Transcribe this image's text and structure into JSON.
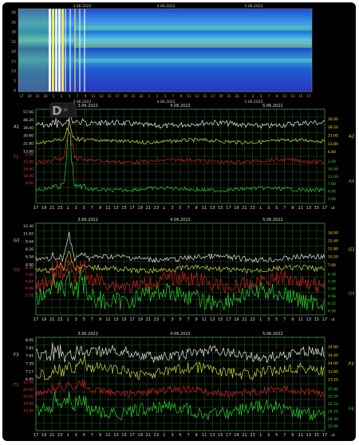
{
  "spectrogram": {
    "date_labels": [
      "3.06.2022",
      "4.06.2022",
      "5.06.2022"
    ],
    "y_ticks": [
      "40",
      "35",
      "30",
      "25",
      "20",
      "15",
      "10",
      "5",
      "0"
    ],
    "hour_ticks": [
      "17",
      "19",
      "21",
      "23",
      "1",
      "3",
      "5",
      "7",
      "9",
      "11",
      "13",
      "15",
      "17",
      "19",
      "21",
      "23",
      "1",
      "3",
      "5",
      "7",
      "9",
      "11",
      "13",
      "15",
      "17",
      "19",
      "21",
      "23",
      "1",
      "3",
      "5",
      "7",
      "9",
      "11",
      "13",
      "15",
      "17"
    ]
  },
  "colors": {
    "white_series": "#e8e8e8",
    "yellow_series": "#d6d645",
    "red_series": "#d42020",
    "green_series": "#2fd12f",
    "grid": "#2a7a2a",
    "left_labels_white": "#e0e0e0",
    "left_labels_red": "#ff3b3b",
    "right_labels_yellow": "#e6e600",
    "right_labels_green": "#2ee02e"
  },
  "chart_data": [
    {
      "type": "line",
      "panel": "A",
      "date_labels": [
        "3.06.2022",
        "4.06.2022",
        "5.06.2022"
      ],
      "x_ticks": [
        "17",
        "19",
        "21",
        "23",
        "1",
        "3",
        "5",
        "7",
        "9",
        "11",
        "13",
        "15",
        "17",
        "19",
        "21",
        "23",
        "1",
        "3",
        "5",
        "7",
        "9",
        "11",
        "13",
        "15",
        "17",
        "19",
        "21",
        "23",
        "1",
        "3",
        "5",
        "7",
        "9",
        "11",
        "13",
        "15",
        "17"
      ],
      "x_unit": "ut",
      "left_axis_labels": [
        "A1",
        "F1"
      ],
      "right_axis_labels": [
        "A2",
        "A4"
      ],
      "left_ticks_white": [
        "57.00",
        "48.20",
        "39.40",
        "30.60",
        "21.80",
        "13.00"
      ],
      "left_ticks_red": [
        "2.00",
        "13.00",
        "16.40",
        "18.40",
        "8.00"
      ],
      "right_ticks_yellow": [
        "36.00",
        "28.20",
        "21.00",
        "13.80",
        "6.60"
      ],
      "right_ticks_green": [
        "2.00",
        "16.00",
        "13.40",
        "7.60",
        "4.60",
        "2.00"
      ],
      "series": [
        {
          "name": "A1",
          "color": "white",
          "baseline": 0.16,
          "amp": 0.03,
          "spike": 0.95
        },
        {
          "name": "A2",
          "color": "yellow",
          "baseline": 0.34,
          "amp": 0.02,
          "spike": 0.75
        },
        {
          "name": "F1",
          "color": "red",
          "baseline": 0.55,
          "amp": 0.02,
          "spike": 0.8
        },
        {
          "name": "A4",
          "color": "green",
          "baseline": 0.85,
          "amp": 0.02,
          "spike": 0.9
        }
      ]
    },
    {
      "type": "line",
      "panel": "G",
      "date_labels": [
        "3.06.2022",
        "4.06.2022",
        "5.06.2022"
      ],
      "x_ticks": [
        "17",
        "19",
        "21",
        "23",
        "1",
        "3",
        "5",
        "7",
        "9",
        "11",
        "13",
        "15",
        "17",
        "19",
        "21",
        "23",
        "1",
        "3",
        "5",
        "7",
        "9",
        "11",
        "13",
        "15",
        "17",
        "19",
        "21",
        "23",
        "1",
        "3",
        "5",
        "7",
        "9",
        "11",
        "13",
        "15",
        "17"
      ],
      "x_unit": "ut",
      "left_axis_labels": [
        "G1",
        "G3"
      ],
      "right_axis_labels": [
        "G2",
        "G4"
      ],
      "left_ticks_white": [
        "13.30",
        "11.62",
        "9.94",
        "8.26",
        "6.58",
        "4.90"
      ],
      "left_ticks_red": [
        "8.36",
        "7.60",
        "6.84",
        "6.08",
        "5.32"
      ],
      "right_ticks_yellow": [
        "18.00",
        "15.40",
        "12.80",
        "10.20",
        "7.60"
      ],
      "right_ticks_green": [
        "6.36",
        "5.90",
        "5.44",
        "4.98",
        "4.52",
        "4.06"
      ],
      "series": [
        {
          "name": "G1",
          "color": "white",
          "baseline": 0.38,
          "amp": 0.03,
          "spike": 0.9
        },
        {
          "name": "G2",
          "color": "yellow",
          "baseline": 0.5,
          "amp": 0.03,
          "spike": 0.5
        },
        {
          "name": "G3",
          "color": "red",
          "baseline": 0.64,
          "amp": 0.08,
          "spike": 0.3
        },
        {
          "name": "G4",
          "color": "green",
          "baseline": 0.8,
          "amp": 0.1,
          "spike": 0.3
        }
      ]
    },
    {
      "type": "line",
      "panel": "F",
      "date_labels": [
        "3.06.2022",
        "4.06.2022",
        "5.06.2022"
      ],
      "x_ticks": [
        "17",
        "19",
        "21",
        "23",
        "1",
        "3",
        "5",
        "7",
        "9",
        "11",
        "13",
        "15",
        "17",
        "19",
        "21",
        "23",
        "1",
        "3",
        "5",
        "7",
        "9",
        "11",
        "13",
        "15",
        "17",
        "19",
        "21",
        "23",
        "1",
        "3",
        "5",
        "7",
        "9",
        "11",
        "13",
        "15",
        "17"
      ],
      "x_unit": "ut",
      "left_axis_labels": [
        "F3",
        "F1"
      ],
      "right_axis_labels": [
        "F2",
        "F4"
      ],
      "left_ticks_white": [
        "8.05",
        "7.83",
        "7.61",
        "7.39",
        "7.17",
        "6.95"
      ],
      "left_ticks_red": [
        "21.00",
        "20.60",
        "20.20",
        "19.80",
        "19.40"
      ],
      "right_ticks_yellow": [
        "14.80",
        "14.40",
        "14.00",
        "13.60",
        "13.20"
      ],
      "right_ticks_green": [
        "25.90",
        "25.50",
        "25.10",
        "24.70",
        "24.30",
        "23.90"
      ],
      "series": [
        {
          "name": "F3",
          "color": "white",
          "baseline": 0.18,
          "amp": 0.06,
          "spike": 0.1
        },
        {
          "name": "F2",
          "color": "yellow",
          "baseline": 0.36,
          "amp": 0.06,
          "spike": 0.15
        },
        {
          "name": "F1",
          "color": "red",
          "baseline": 0.58,
          "amp": 0.04,
          "spike": 0.15
        },
        {
          "name": "F4",
          "color": "green",
          "baseline": 0.78,
          "amp": 0.07,
          "spike": 0.15
        }
      ]
    }
  ]
}
